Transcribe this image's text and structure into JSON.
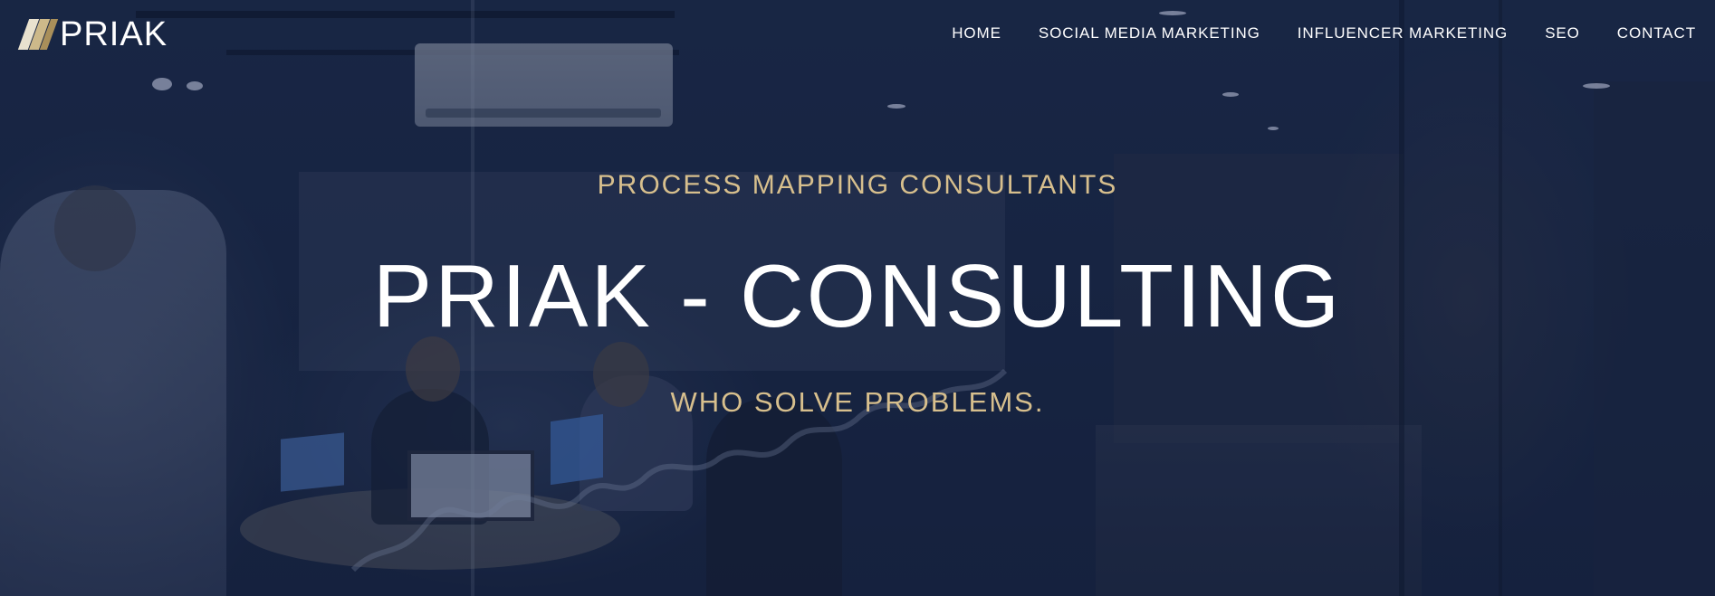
{
  "brand": {
    "name": "PRIAK",
    "colors": {
      "gold": "#d7bf8d",
      "navy": "#16233f",
      "white": "#ffffff"
    }
  },
  "nav": {
    "items": [
      {
        "label": "HOME"
      },
      {
        "label": "SOCIAL MEDIA MARKETING"
      },
      {
        "label": "INFLUENCER MARKETING"
      },
      {
        "label": "SEO"
      },
      {
        "label": "CONTACT"
      }
    ]
  },
  "hero": {
    "eyebrow": "PROCESS MAPPING CONSULTANTS",
    "title": "PRIAK - CONSULTING",
    "tagline": "WHO SOLVE PROBLEMS."
  }
}
